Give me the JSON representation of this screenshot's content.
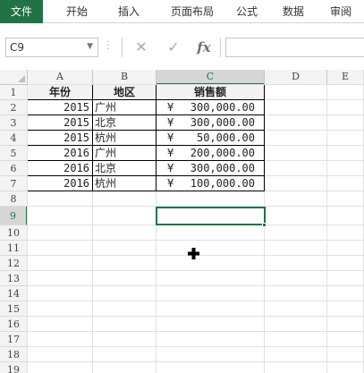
{
  "ribbon": {
    "tabs": [
      {
        "label": "文件",
        "active": true
      },
      {
        "label": "开始",
        "active": false
      },
      {
        "label": "插入",
        "active": false
      },
      {
        "label": "页面布局",
        "active": false
      },
      {
        "label": "公式",
        "active": false
      },
      {
        "label": "数据",
        "active": false
      },
      {
        "label": "审阅",
        "active": false
      }
    ],
    "accent_color": "#217346"
  },
  "formula_bar": {
    "name_box": "C9",
    "formula": "",
    "cancel_icon": "cancel-x-icon",
    "enter_icon": "checkmark-icon",
    "function_label": "fx"
  },
  "grid": {
    "column_headers": [
      "A",
      "B",
      "C",
      "D",
      "E"
    ],
    "row_headers": [
      "1",
      "2",
      "3",
      "4",
      "5",
      "6",
      "7",
      "8",
      "9",
      "10",
      "11",
      "12",
      "13",
      "14",
      "15",
      "16",
      "17",
      "18",
      "19"
    ],
    "selected_cell": "C9",
    "table": {
      "headers": [
        "年份",
        "地区",
        "销售额"
      ],
      "rows": [
        {
          "year": "2015",
          "region": "广州",
          "currency": "¥",
          "amount": "300,000.00"
        },
        {
          "year": "2015",
          "region": "北京",
          "currency": "¥",
          "amount": "300,000.00"
        },
        {
          "year": "2015",
          "region": "杭州",
          "currency": "¥",
          "amount": "50,000.00"
        },
        {
          "year": "2016",
          "region": "广州",
          "currency": "¥",
          "amount": "200,000.00"
        },
        {
          "year": "2016",
          "region": "北京",
          "currency": "¥",
          "amount": "300,000.00"
        },
        {
          "year": "2016",
          "region": "杭州",
          "currency": "¥",
          "amount": "100,000.00"
        }
      ]
    }
  }
}
